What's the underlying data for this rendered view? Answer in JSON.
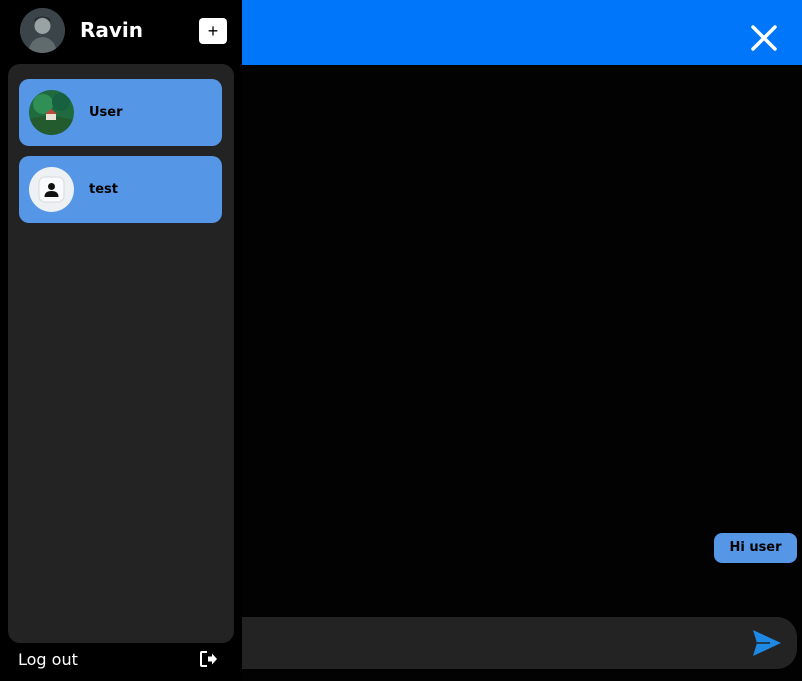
{
  "sidebar": {
    "profile": {
      "name": "Ravin",
      "avatar_icon": "user-photo-avatar"
    },
    "add_button_label": "+",
    "contacts": [
      {
        "name": "User",
        "avatar_icon": "landscape-photo-avatar"
      },
      {
        "name": "test",
        "avatar_icon": "default-person-avatar"
      }
    ],
    "logout_label": "Log out"
  },
  "chat": {
    "header_color": "#0076fb",
    "messages": [
      {
        "text": "Hi user",
        "side": "right"
      }
    ],
    "input": {
      "value": "",
      "placeholder": ""
    }
  },
  "colors": {
    "accent": "#0076fb",
    "card": "#5596e6",
    "panel": "#232323",
    "send": "#1e88e5"
  }
}
